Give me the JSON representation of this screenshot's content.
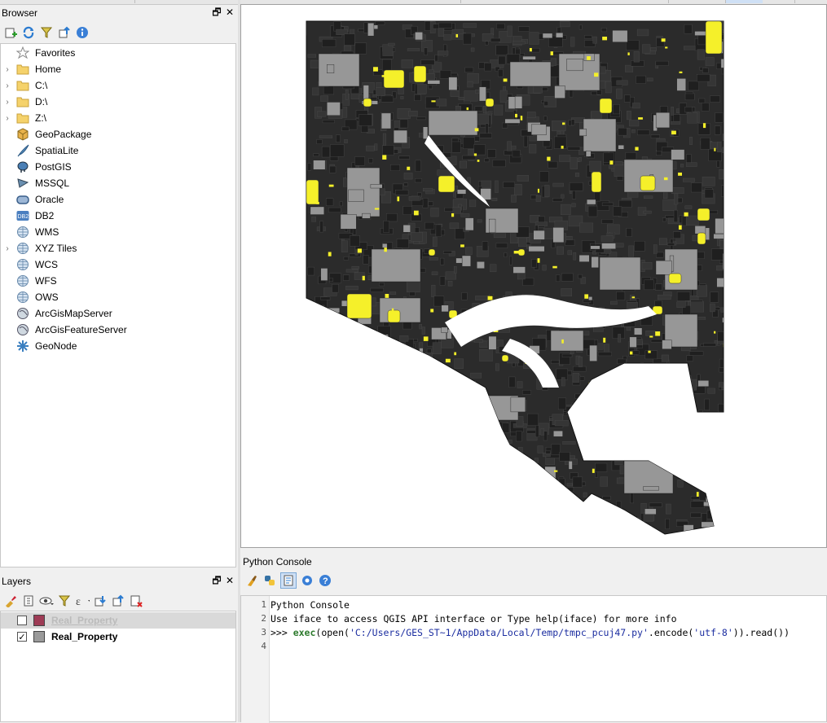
{
  "browser": {
    "title": "Browser",
    "items": [
      {
        "label": "Favorites",
        "icon": "favorites-star-icon",
        "expandable": false
      },
      {
        "label": "Home",
        "icon": "folder-icon",
        "expandable": true
      },
      {
        "label": "C:\\",
        "icon": "folder-icon",
        "expandable": true
      },
      {
        "label": "D:\\",
        "icon": "folder-icon",
        "expandable": true
      },
      {
        "label": "Z:\\",
        "icon": "folder-icon",
        "expandable": true
      },
      {
        "label": "GeoPackage",
        "icon": "geopackage-icon",
        "expandable": false
      },
      {
        "label": "SpatiaLite",
        "icon": "spatialite-feather-icon",
        "expandable": false
      },
      {
        "label": "PostGIS",
        "icon": "postgis-elephant-icon",
        "expandable": false
      },
      {
        "label": "MSSQL",
        "icon": "mssql-icon",
        "expandable": false
      },
      {
        "label": "Oracle",
        "icon": "oracle-icon",
        "expandable": false
      },
      {
        "label": "DB2",
        "icon": "db2-icon",
        "expandable": false
      },
      {
        "label": "WMS",
        "icon": "globe-icon",
        "expandable": false
      },
      {
        "label": "XYZ Tiles",
        "icon": "globe-icon",
        "expandable": true
      },
      {
        "label": "WCS",
        "icon": "globe-icon",
        "expandable": false
      },
      {
        "label": "WFS",
        "icon": "globe-icon",
        "expandable": false
      },
      {
        "label": "OWS",
        "icon": "globe-icon",
        "expandable": false
      },
      {
        "label": "ArcGisMapServer",
        "icon": "arcgis-globe-icon",
        "expandable": false
      },
      {
        "label": "ArcGisFeatureServer",
        "icon": "arcgis-globe-icon",
        "expandable": false
      },
      {
        "label": "GeoNode",
        "icon": "geonode-icon",
        "expandable": false
      }
    ],
    "db2_icon_text": "DB2"
  },
  "layers": {
    "title": "Layers",
    "items": [
      {
        "name": "Real_Property",
        "checked": false,
        "swatch_color": "#9e3b55",
        "selected": true
      },
      {
        "name": "Real_Property",
        "checked": true,
        "swatch_color": "#9a9a9a",
        "selected": false
      }
    ]
  },
  "dock_controls": {
    "float": "🗗",
    "close": "✕"
  },
  "console": {
    "title": "Python Console",
    "lines": [
      {
        "num": "1",
        "text": "Python Console"
      },
      {
        "num": "2",
        "text": "Use iface to access QGIS API interface or Type help(iface) for more info"
      },
      {
        "num": "3",
        "prompt": ">>> ",
        "keyword": "exec",
        "open_call": "(open(",
        "path": "'C:/Users/GES_ST~1/AppData/Local/Temp/tmpc_pcuj47.py'",
        "encode_call": ".encode(",
        "encoding": "'utf-8'",
        "end": ")).read())"
      },
      {
        "num": "4",
        "text": ""
      }
    ]
  },
  "map": {
    "layer_colors": {
      "parcel_fill": "#2b2b2b",
      "parcel_grey": "#979797",
      "highlight": "#f5f02a",
      "water": "#ffffff"
    }
  }
}
